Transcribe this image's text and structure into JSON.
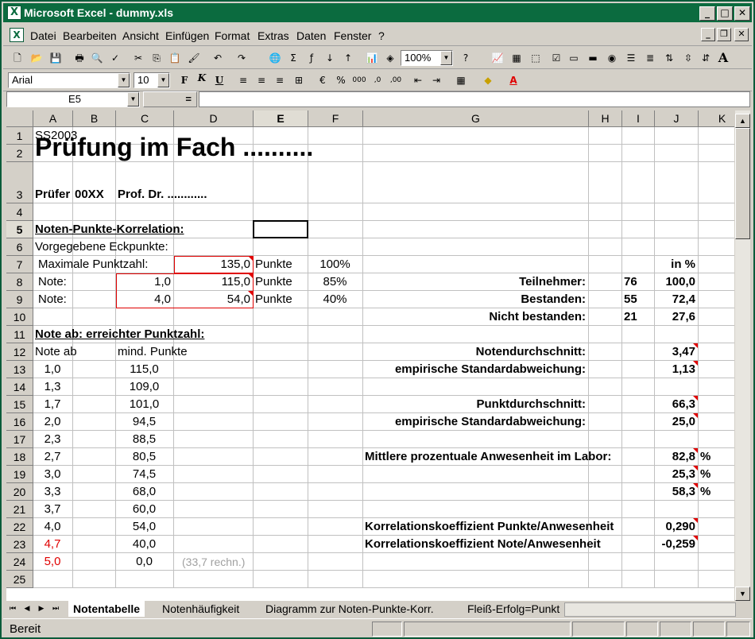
{
  "window": {
    "title": "Microsoft Excel - dummy.xls",
    "app_icon": "excel-icon",
    "min": "_",
    "max": "□",
    "close": "✕"
  },
  "menu": [
    "Datei",
    "Bearbeiten",
    "Ansicht",
    "Einfügen",
    "Format",
    "Extras",
    "Daten",
    "Fenster",
    "?"
  ],
  "toolbar": {
    "zoom": "100%",
    "font": "Arial",
    "size": "10"
  },
  "formula": {
    "name_box": "E5",
    "equals": "=",
    "content": ""
  },
  "columns": [
    "A",
    "B",
    "C",
    "D",
    "E",
    "F",
    "G",
    "H",
    "I",
    "J",
    "K"
  ],
  "selected_cell": "E5",
  "cells": {
    "A1": "SS2003",
    "A2": "Prüfung im Fach ..........",
    "A3": "Prüfer",
    "B3": "00XX",
    "C3": "Prof. Dr. ............",
    "A5": "Noten-Punkte-Korrelation:",
    "A6": "Vorgegebene Eckpunkte:",
    "A7": "Maximale Punktzahl:",
    "D7": "135,0",
    "E7": "Punkte",
    "F7": "100%",
    "J7": "in %",
    "A8": "Note:",
    "C8": "1,0",
    "D8": "115,0",
    "E8": "Punkte",
    "F8": "85%",
    "G8": "Teilnehmer:",
    "I8": "76",
    "J8": "100,0",
    "A9": "Note:",
    "C9": "4,0",
    "D9": "54,0",
    "E9": "Punkte",
    "F9": "40%",
    "G9": "Bestanden:",
    "I9": "55",
    "J9": "72,4",
    "G10": "Nicht bestanden:",
    "I10": "21",
    "J10": "27,6",
    "A11": "Note  ab:  erreichter Punktzahl:",
    "A12": "Note ab",
    "C12": "mind. Punkte",
    "G12": "Notendurchschnitt:",
    "J12": "3,47",
    "A13": "1,0",
    "C13": "115,0",
    "G13": "empirische Standardabweichung:",
    "J13": "1,13",
    "A14": "1,3",
    "C14": "109,0",
    "A15": "1,7",
    "C15": "101,0",
    "G15": "Punktdurchschnitt:",
    "J15": "66,3",
    "A16": "2,0",
    "C16": "94,5",
    "G16": "empirische Standardabweichung:",
    "J16": "25,0",
    "A17": "2,3",
    "C17": "88,5",
    "A18": "2,7",
    "C18": "80,5",
    "G18": "Mittlere prozentuale Anwesenheit im Labor:",
    "J18": "82,8",
    "K18": "%",
    "A19": "3,0",
    "C19": "74,5",
    "J19": "25,3",
    "K19": "%",
    "A20": "3,3",
    "C20": "68,0",
    "J20": "58,3",
    "K20": "%",
    "A21": "3,7",
    "C21": "60,0",
    "A22": "4,0",
    "C22": "54,0",
    "G22": "Korrelationskoeffizient Punkte/Anwesenheit",
    "J22": "0,290",
    "A23": "4,7",
    "C23": "40,0",
    "G23": "Korrelationskoeffizient Note/Anwesenheit",
    "J23": "-0,259",
    "A24": "5,0",
    "C24": "0,0",
    "D24": "(33,7 rechn.)"
  },
  "sheets": [
    "Notentabelle",
    "Notenhäufigkeit",
    "Diagramm zur Noten-Punkte-Korr.",
    "Fleiß-Erfolg=Punkt"
  ],
  "active_sheet": "Notentabelle",
  "status": "Bereit",
  "colors": {
    "title_bar": "#0b6b3f",
    "input_border": "#e00000",
    "comment_marker": "#e00000"
  }
}
